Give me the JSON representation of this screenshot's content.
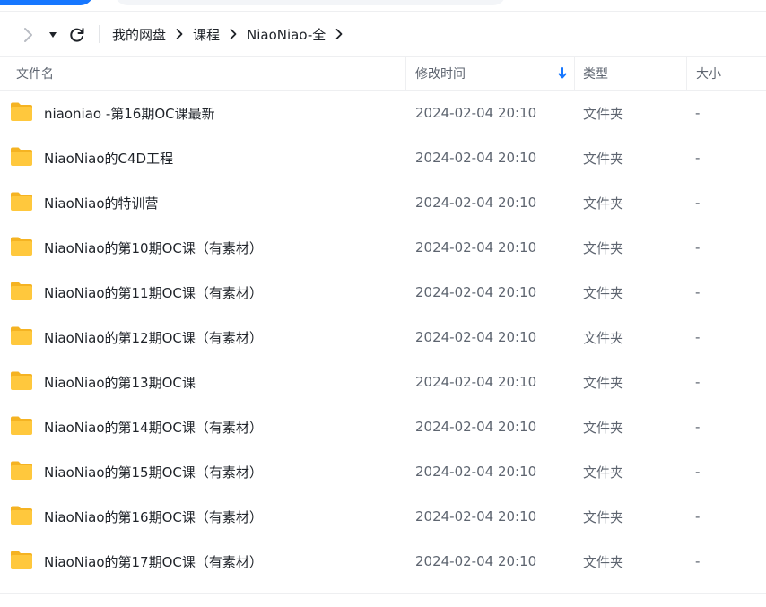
{
  "colors": {
    "accent": "#1677ff",
    "folder": "#ffc83d",
    "folder_back": "#f5b322"
  },
  "nav": {
    "forward_icon": "chevron-right-icon",
    "dropdown_icon": "caret-down-icon",
    "refresh_icon": "refresh-icon"
  },
  "breadcrumb": [
    {
      "label": "我的网盘"
    },
    {
      "label": "课程"
    },
    {
      "label": "NiaoNiao-全"
    }
  ],
  "columns": {
    "name": "文件名",
    "modified": "修改时间",
    "type": "类型",
    "size": "大小",
    "sort_icon": "arrow-down-icon"
  },
  "files": [
    {
      "name": "niaoniao -第16期OC课最新",
      "modified": "2024-02-04 20:10",
      "type": "文件夹",
      "size": "-"
    },
    {
      "name": "NiaoNiao的C4D工程",
      "modified": "2024-02-04 20:10",
      "type": "文件夹",
      "size": "-"
    },
    {
      "name": "NiaoNiao的特训营",
      "modified": "2024-02-04 20:10",
      "type": "文件夹",
      "size": "-"
    },
    {
      "name": "NiaoNiao的第10期OC课（有素材）",
      "modified": "2024-02-04 20:10",
      "type": "文件夹",
      "size": "-"
    },
    {
      "name": "NiaoNiao的第11期OC课（有素材）",
      "modified": "2024-02-04 20:10",
      "type": "文件夹",
      "size": "-"
    },
    {
      "name": "NiaoNiao的第12期OC课（有素材）",
      "modified": "2024-02-04 20:10",
      "type": "文件夹",
      "size": "-"
    },
    {
      "name": "NiaoNiao的第13期OC课",
      "modified": "2024-02-04 20:10",
      "type": "文件夹",
      "size": "-"
    },
    {
      "name": "NiaoNiao的第14期OC课（有素材）",
      "modified": "2024-02-04 20:10",
      "type": "文件夹",
      "size": "-"
    },
    {
      "name": "NiaoNiao的第15期OC课（有素材）",
      "modified": "2024-02-04 20:10",
      "type": "文件夹",
      "size": "-"
    },
    {
      "name": "NiaoNiao的第16期OC课（有素材）",
      "modified": "2024-02-04 20:10",
      "type": "文件夹",
      "size": "-"
    },
    {
      "name": "NiaoNiao的第17期OC课（有素材）",
      "modified": "2024-02-04 20:10",
      "type": "文件夹",
      "size": "-"
    }
  ]
}
